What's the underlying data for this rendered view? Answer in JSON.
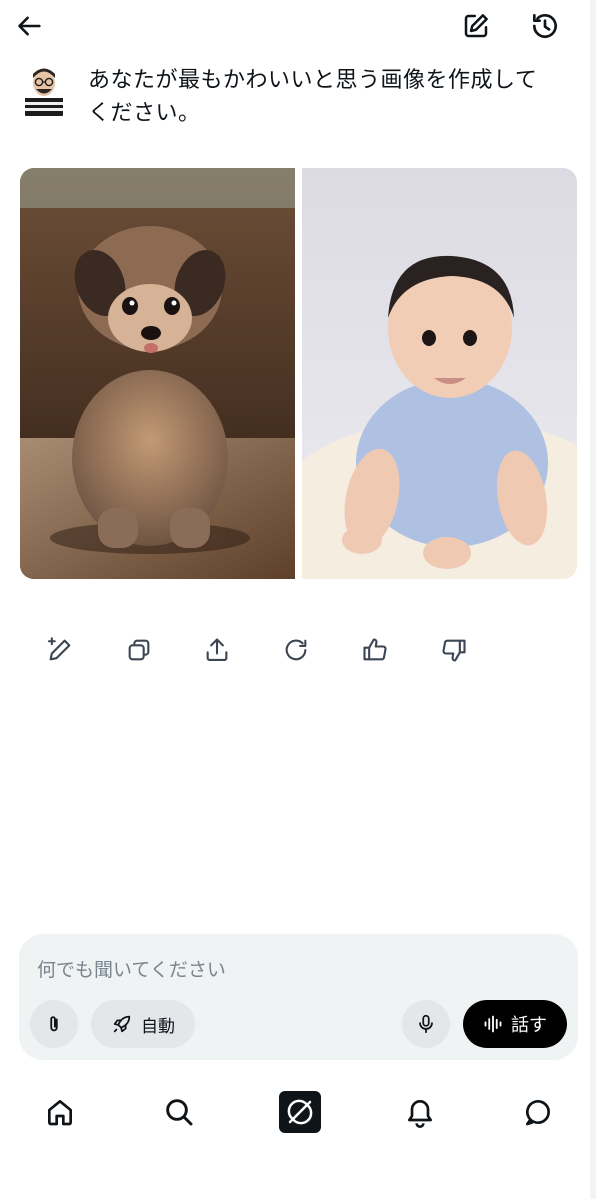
{
  "prompt": {
    "text": "あなたが最もかわいいと思う画像を作成してください。"
  },
  "images": [
    {
      "subject": "puppy"
    },
    {
      "subject": "baby"
    }
  ],
  "actions": [
    "edit-image-icon",
    "copy-icon",
    "share-icon",
    "regenerate-icon",
    "thumbs-up-icon",
    "thumbs-down-icon"
  ],
  "composer": {
    "placeholder": "何でも聞いてください",
    "mode_label": "自動",
    "talk_label": "話す"
  },
  "nav": [
    "home-icon",
    "search-icon",
    "grok-icon",
    "notifications-icon",
    "messages-icon"
  ],
  "colors": {
    "text": "#0f1419",
    "composer_bg": "#eff3f4",
    "pill_bg": "#e3e7ea",
    "talk_bg": "#000000"
  }
}
